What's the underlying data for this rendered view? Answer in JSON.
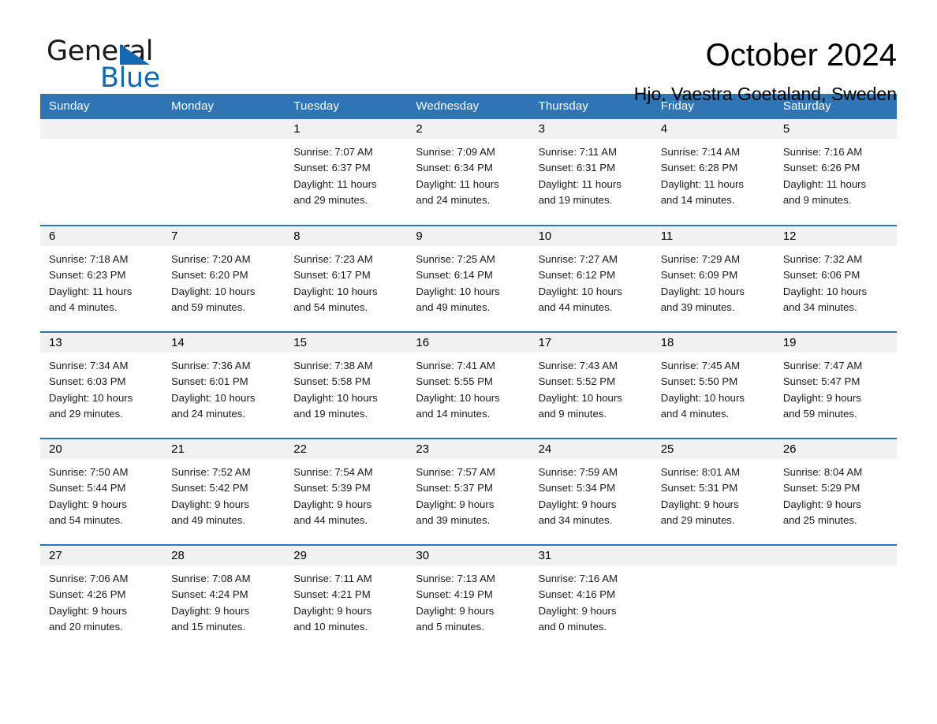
{
  "brand": {
    "name_part1": "General",
    "name_part2": "Blue",
    "triangle_color": "#1268b3",
    "text_color": "#1a1a1a"
  },
  "header": {
    "title": "October 2024",
    "subtitle": "Hjo, Vaestra Goetaland, Sweden"
  },
  "theme": {
    "header_blue": "#2f75b5",
    "daynum_gray": "#f1f1f1",
    "row_rule": "#2f75b5"
  },
  "calendar": {
    "weekday_headers": [
      "Sunday",
      "Monday",
      "Tuesday",
      "Wednesday",
      "Thursday",
      "Friday",
      "Saturday"
    ],
    "weeks": [
      [
        {
          "day": "",
          "info": ""
        },
        {
          "day": "",
          "info": ""
        },
        {
          "day": "1",
          "info": "Sunrise: 7:07 AM\nSunset: 6:37 PM\nDaylight: 11 hours\nand 29 minutes."
        },
        {
          "day": "2",
          "info": "Sunrise: 7:09 AM\nSunset: 6:34 PM\nDaylight: 11 hours\nand 24 minutes."
        },
        {
          "day": "3",
          "info": "Sunrise: 7:11 AM\nSunset: 6:31 PM\nDaylight: 11 hours\nand 19 minutes."
        },
        {
          "day": "4",
          "info": "Sunrise: 7:14 AM\nSunset: 6:28 PM\nDaylight: 11 hours\nand 14 minutes."
        },
        {
          "day": "5",
          "info": "Sunrise: 7:16 AM\nSunset: 6:26 PM\nDaylight: 11 hours\nand 9 minutes."
        }
      ],
      [
        {
          "day": "6",
          "info": "Sunrise: 7:18 AM\nSunset: 6:23 PM\nDaylight: 11 hours\nand 4 minutes."
        },
        {
          "day": "7",
          "info": "Sunrise: 7:20 AM\nSunset: 6:20 PM\nDaylight: 10 hours\nand 59 minutes."
        },
        {
          "day": "8",
          "info": "Sunrise: 7:23 AM\nSunset: 6:17 PM\nDaylight: 10 hours\nand 54 minutes."
        },
        {
          "day": "9",
          "info": "Sunrise: 7:25 AM\nSunset: 6:14 PM\nDaylight: 10 hours\nand 49 minutes."
        },
        {
          "day": "10",
          "info": "Sunrise: 7:27 AM\nSunset: 6:12 PM\nDaylight: 10 hours\nand 44 minutes."
        },
        {
          "day": "11",
          "info": "Sunrise: 7:29 AM\nSunset: 6:09 PM\nDaylight: 10 hours\nand 39 minutes."
        },
        {
          "day": "12",
          "info": "Sunrise: 7:32 AM\nSunset: 6:06 PM\nDaylight: 10 hours\nand 34 minutes."
        }
      ],
      [
        {
          "day": "13",
          "info": "Sunrise: 7:34 AM\nSunset: 6:03 PM\nDaylight: 10 hours\nand 29 minutes."
        },
        {
          "day": "14",
          "info": "Sunrise: 7:36 AM\nSunset: 6:01 PM\nDaylight: 10 hours\nand 24 minutes."
        },
        {
          "day": "15",
          "info": "Sunrise: 7:38 AM\nSunset: 5:58 PM\nDaylight: 10 hours\nand 19 minutes."
        },
        {
          "day": "16",
          "info": "Sunrise: 7:41 AM\nSunset: 5:55 PM\nDaylight: 10 hours\nand 14 minutes."
        },
        {
          "day": "17",
          "info": "Sunrise: 7:43 AM\nSunset: 5:52 PM\nDaylight: 10 hours\nand 9 minutes."
        },
        {
          "day": "18",
          "info": "Sunrise: 7:45 AM\nSunset: 5:50 PM\nDaylight: 10 hours\nand 4 minutes."
        },
        {
          "day": "19",
          "info": "Sunrise: 7:47 AM\nSunset: 5:47 PM\nDaylight: 9 hours\nand 59 minutes."
        }
      ],
      [
        {
          "day": "20",
          "info": "Sunrise: 7:50 AM\nSunset: 5:44 PM\nDaylight: 9 hours\nand 54 minutes."
        },
        {
          "day": "21",
          "info": "Sunrise: 7:52 AM\nSunset: 5:42 PM\nDaylight: 9 hours\nand 49 minutes."
        },
        {
          "day": "22",
          "info": "Sunrise: 7:54 AM\nSunset: 5:39 PM\nDaylight: 9 hours\nand 44 minutes."
        },
        {
          "day": "23",
          "info": "Sunrise: 7:57 AM\nSunset: 5:37 PM\nDaylight: 9 hours\nand 39 minutes."
        },
        {
          "day": "24",
          "info": "Sunrise: 7:59 AM\nSunset: 5:34 PM\nDaylight: 9 hours\nand 34 minutes."
        },
        {
          "day": "25",
          "info": "Sunrise: 8:01 AM\nSunset: 5:31 PM\nDaylight: 9 hours\nand 29 minutes."
        },
        {
          "day": "26",
          "info": "Sunrise: 8:04 AM\nSunset: 5:29 PM\nDaylight: 9 hours\nand 25 minutes."
        }
      ],
      [
        {
          "day": "27",
          "info": "Sunrise: 7:06 AM\nSunset: 4:26 PM\nDaylight: 9 hours\nand 20 minutes."
        },
        {
          "day": "28",
          "info": "Sunrise: 7:08 AM\nSunset: 4:24 PM\nDaylight: 9 hours\nand 15 minutes."
        },
        {
          "day": "29",
          "info": "Sunrise: 7:11 AM\nSunset: 4:21 PM\nDaylight: 9 hours\nand 10 minutes."
        },
        {
          "day": "30",
          "info": "Sunrise: 7:13 AM\nSunset: 4:19 PM\nDaylight: 9 hours\nand 5 minutes."
        },
        {
          "day": "31",
          "info": "Sunrise: 7:16 AM\nSunset: 4:16 PM\nDaylight: 9 hours\nand 0 minutes."
        },
        {
          "day": "",
          "info": ""
        },
        {
          "day": "",
          "info": ""
        }
      ]
    ]
  }
}
